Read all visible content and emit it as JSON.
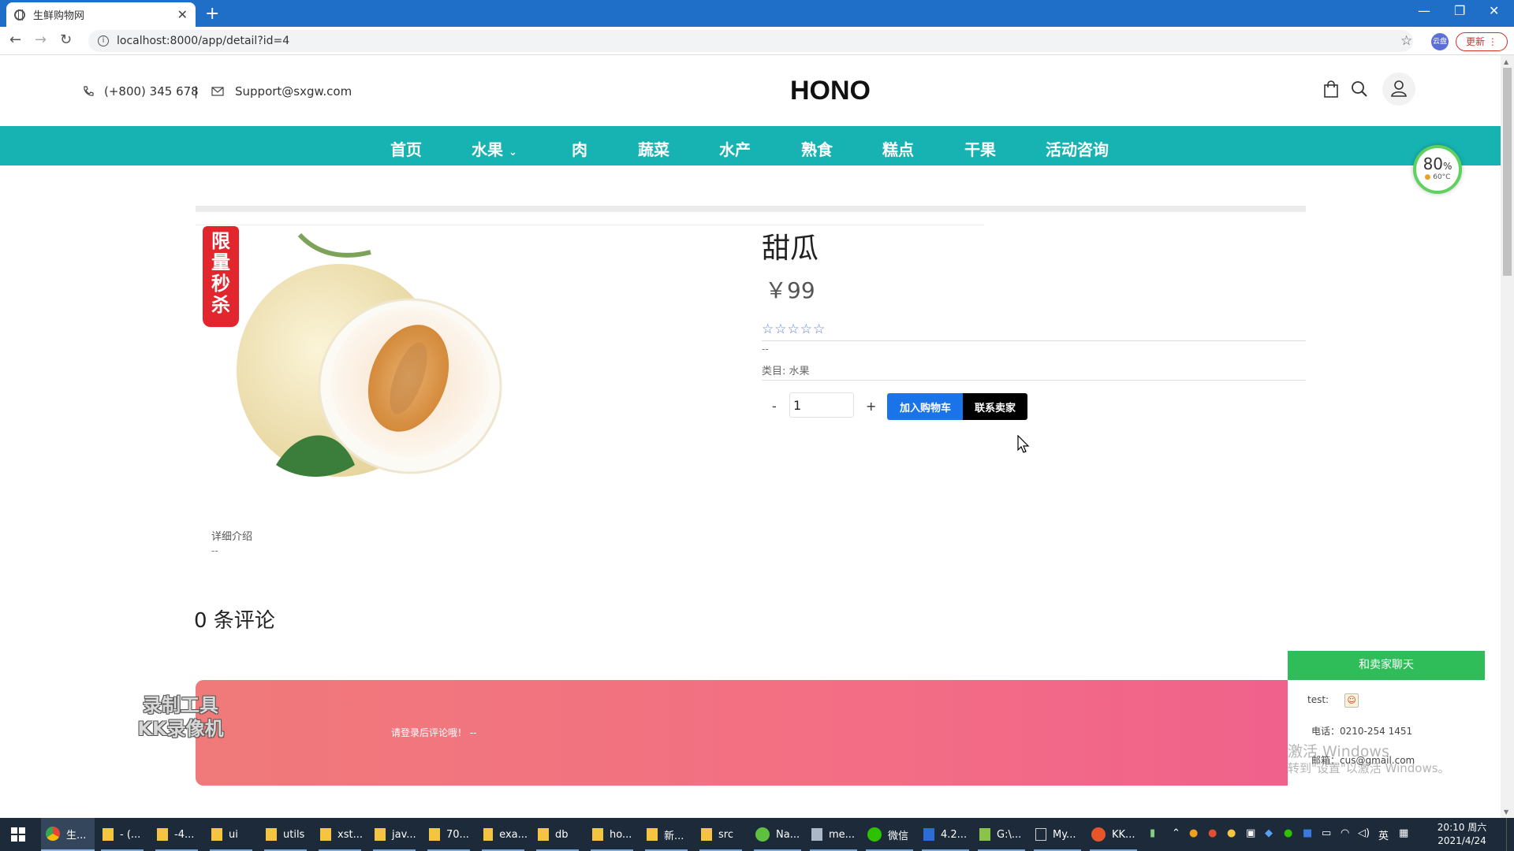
{
  "browser": {
    "tab_title": "生鲜购物网",
    "tab_close": "✕",
    "new_tab": "+",
    "url": "localhost:8000/app/detail?id=4",
    "ext_label": "云盘",
    "update_label": "更新"
  },
  "header": {
    "phone": "(+800) 345 678",
    "divider": "|",
    "email": "Support@sxgw.com",
    "logo": "HONO"
  },
  "nav": {
    "items": [
      "首页",
      "水果",
      "肉",
      "蔬菜",
      "水产",
      "熟食",
      "糕点",
      "干果",
      "活动咨询"
    ]
  },
  "gauge": {
    "percent": "80",
    "unit": "%",
    "temp": "60°C"
  },
  "product": {
    "badge": "限量秒杀",
    "name": "甜瓜",
    "price": "￥99",
    "rating_stars": "☆☆☆☆☆",
    "rating_value": 0,
    "short_desc": "--",
    "category": "类目: 水果",
    "qty_minus": "-",
    "quantity": "1",
    "qty_plus": "+",
    "add_to_cart": "加入购物车",
    "contact_seller": "联系卖家",
    "detail_title": "详细介绍",
    "detail_text": "--"
  },
  "comments": {
    "count_label": "0 条评论",
    "login_prompt": "请登录后评论哦！ --"
  },
  "watermark": {
    "line1": "录制工具",
    "line2": "KK录像机"
  },
  "chat": {
    "title": "和卖家聊天",
    "qq_label": "test:",
    "phone": "电话：0210-254 1451",
    "email": "邮箱：cus@gmail.com"
  },
  "activation": {
    "line1": "激活 Windows",
    "line2": "转到\"设置\"以激活 Windows。"
  },
  "taskbar": {
    "items": [
      "生...",
      "- (...",
      "-4...",
      "ui",
      "utils",
      "xst...",
      "jav...",
      "70...",
      "exa...",
      "db",
      "ho...",
      "新...",
      "src",
      "Na...",
      "me...",
      "微信",
      "4.2...",
      "G:\\...",
      "My...",
      "KK..."
    ],
    "ime": "英",
    "time": "20:10 周六",
    "date": "2021/4/24"
  }
}
